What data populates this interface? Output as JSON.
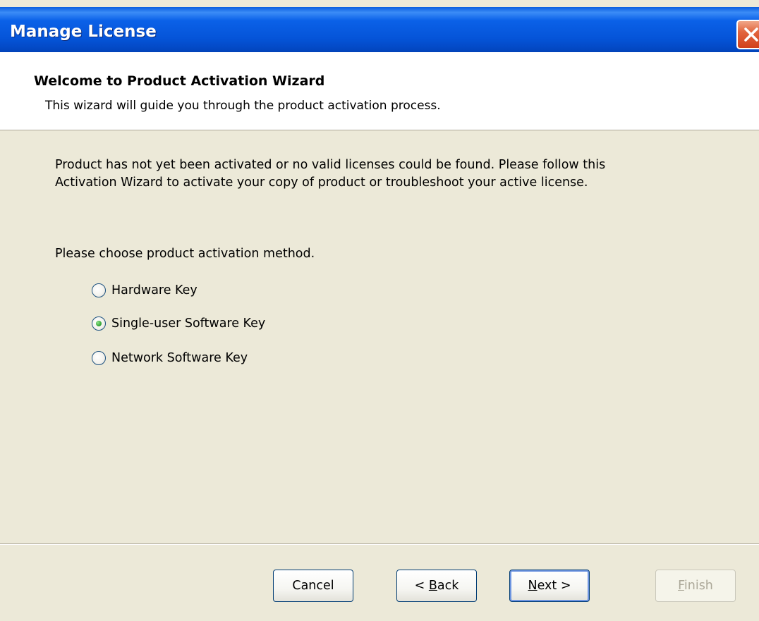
{
  "window": {
    "title": "Manage License"
  },
  "header": {
    "title": "Welcome to Product Activation Wizard",
    "subtitle": "This wizard will guide you through the product activation process."
  },
  "main": {
    "message_line1": "Product has not yet been activated or no valid licenses could be found. Please follow this",
    "message_line2": "Activation Wizard to activate your copy of product or troubleshoot your active license.",
    "choose_label": "Please choose product activation method.",
    "options": [
      {
        "label": "Hardware Key",
        "selected": false
      },
      {
        "label": "Single-user Software Key",
        "selected": true
      },
      {
        "label": "Network Software Key",
        "selected": false
      }
    ]
  },
  "footer": {
    "cancel_label": "Cancel",
    "back_prefix": "< ",
    "back_mnemonic": "B",
    "back_rest": "ack",
    "next_mnemonic": "N",
    "next_rest": "ext >",
    "finish_mnemonic": "F",
    "finish_rest": "inish"
  },
  "colors": {
    "titlebar": "#0554d8",
    "dialog_bg": "#ece9d8",
    "close_button": "#d1401c",
    "radio_checked": "#3aa83a"
  },
  "icons": {
    "close": "close-icon"
  }
}
